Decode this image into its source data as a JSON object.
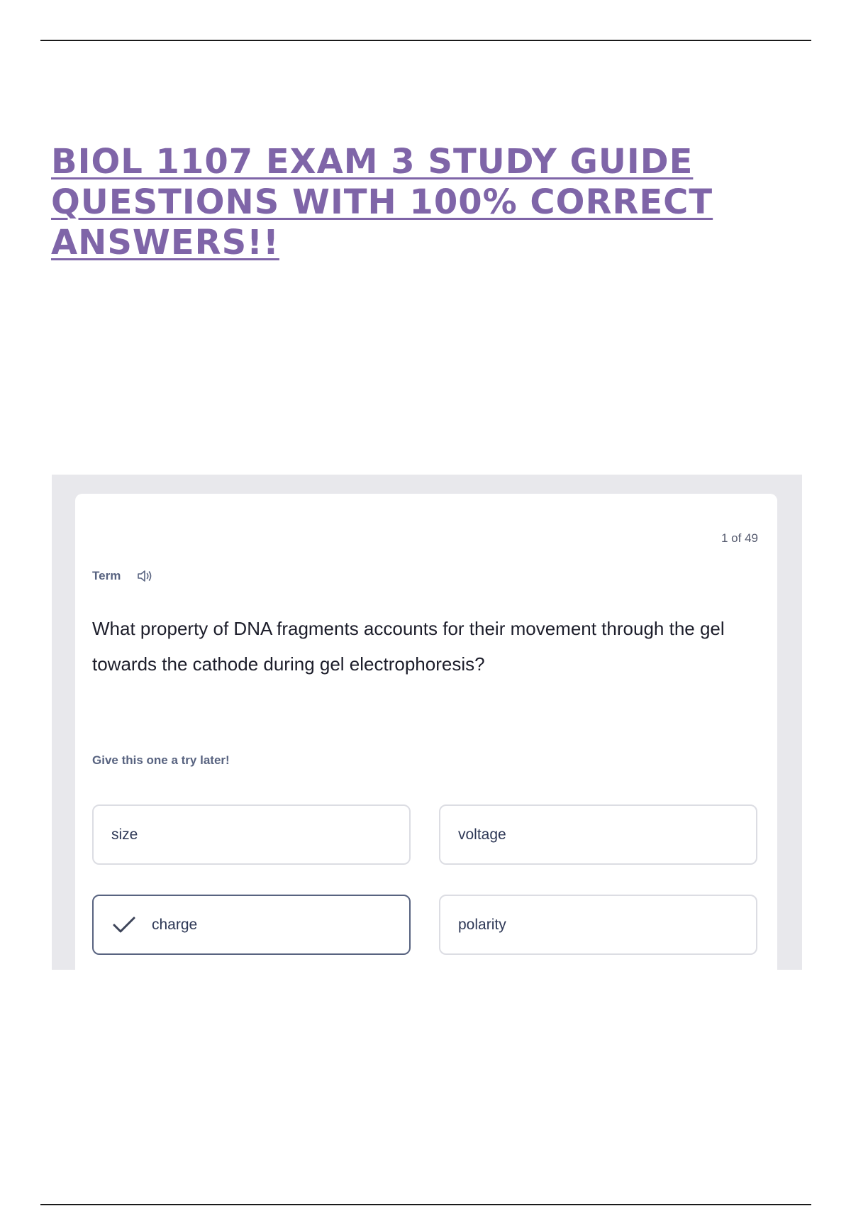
{
  "document": {
    "title": "BIOL 1107 EXAM 3 STUDY GUIDE QUESTIONS WITH 100% CORRECT ANSWERS!!"
  },
  "flashcard": {
    "counter": "1 of 49",
    "term_label": "Term",
    "question": "What property of DNA fragments accounts for their movement through the gel towards the cathode during gel electrophoresis?",
    "hint": "Give this one a try later!",
    "options": [
      {
        "label": "size",
        "selected": false
      },
      {
        "label": "voltage",
        "selected": false
      },
      {
        "label": "charge",
        "selected": true
      },
      {
        "label": "polarity",
        "selected": false
      }
    ]
  },
  "icons": {
    "speaker": "speaker-icon",
    "check": "checkmark-icon"
  },
  "colors": {
    "title": "#7f65a8",
    "muted_text": "#586380",
    "option_border": "#dcdde3",
    "selected_border": "#586380",
    "frame_background": "#e8e8ec"
  }
}
